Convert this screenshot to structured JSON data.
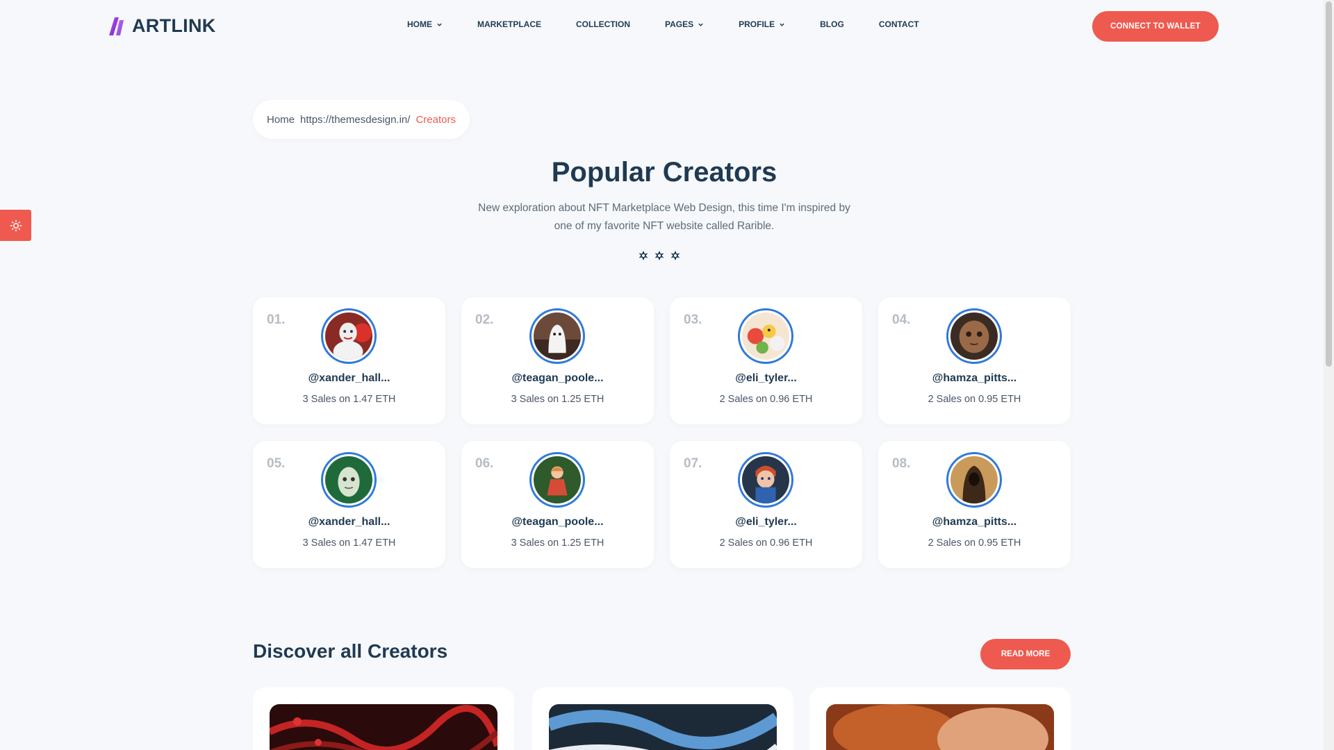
{
  "header": {
    "logo_text": "ARTLINK",
    "nav": [
      {
        "label": "HOME",
        "dropdown": true
      },
      {
        "label": "MARKETPLACE",
        "dropdown": false
      },
      {
        "label": "COLLECTION",
        "dropdown": false
      },
      {
        "label": "PAGES",
        "dropdown": true
      },
      {
        "label": "PROFILE",
        "dropdown": true
      },
      {
        "label": "BLOG",
        "dropdown": false
      },
      {
        "label": "CONTACT",
        "dropdown": false
      }
    ],
    "wallet_button": "CONNECT TO WALLET"
  },
  "breadcrumb": {
    "home": "Home",
    "url": "https://themesdesign.in/",
    "current": "Creators"
  },
  "hero": {
    "title": "Popular Creators",
    "subtitle": "New exploration about NFT Marketplace Web Design, this time I'm inspired by one of my favorite NFT website called Rarible."
  },
  "creators": [
    {
      "rank": "01.",
      "name": "@xander_hall...",
      "sales": "3 Sales on 1.47 ETH",
      "avatar": "clown-avatar"
    },
    {
      "rank": "02.",
      "name": "@teagan_poole...",
      "sales": "3 Sales on 1.25 ETH",
      "avatar": "ghost-avatar"
    },
    {
      "rank": "03.",
      "name": "@eli_tyler...",
      "sales": "2 Sales on 0.96 ETH",
      "avatar": "toys-avatar"
    },
    {
      "rank": "04.",
      "name": "@hamza_pitts...",
      "sales": "2 Sales on 0.95 ETH",
      "avatar": "doll-face-avatar"
    },
    {
      "rank": "05.",
      "name": "@xander_hall...",
      "sales": "3 Sales on 1.47 ETH",
      "avatar": "egg-avatar"
    },
    {
      "rank": "06.",
      "name": "@teagan_poole...",
      "sales": "3 Sales on 1.25 ETH",
      "avatar": "girl-figure-avatar"
    },
    {
      "rank": "07.",
      "name": "@eli_tyler...",
      "sales": "2 Sales on 0.96 ETH",
      "avatar": "chucky-avatar"
    },
    {
      "rank": "08.",
      "name": "@hamza_pitts...",
      "sales": "2 Sales on 0.95 ETH",
      "avatar": "hooded-figure-avatar"
    }
  ],
  "discover": {
    "title": "Discover all Creators",
    "read_more": "READ MORE"
  },
  "colors": {
    "accent": "#ee5a4f",
    "heading": "#1f3a52",
    "avatar_ring": "#2f7ad8",
    "background": "#f7f8fb"
  }
}
